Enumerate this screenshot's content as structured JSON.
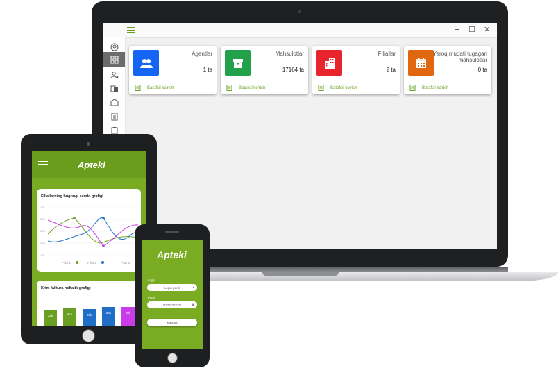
{
  "laptop": {
    "window_controls": {
      "minimize": "−",
      "maximize": "☐",
      "close": "✕"
    },
    "sidebar": {
      "items": [
        "user-circle-icon",
        "dashboard-icon",
        "user-settings-icon",
        "copy-icon",
        "box-icon",
        "document-icon",
        "clipboard-icon"
      ],
      "active_index": 1
    },
    "cards": [
      {
        "title": "Agentlar",
        "value": "1 ta",
        "link": "Batafsil ko'rish",
        "icon": "users-icon",
        "color": "#1565f5"
      },
      {
        "title": "Mahsulotlar",
        "value": "17164 ta",
        "link": "Batafsil ko'rish",
        "icon": "box-icon",
        "color": "#23a04a"
      },
      {
        "title": "Filiallar",
        "value": "2 ta",
        "link": "Batafsil ko'rish",
        "icon": "building-icon",
        "color": "#e8252d"
      },
      {
        "title": "Yaroq mudati tugagan mahsulotlar",
        "value": "0 ta",
        "link": "Batafsil ko'rish",
        "icon": "calendar-icon",
        "color": "#e0660f"
      }
    ]
  },
  "tablet": {
    "brand": "Apteki",
    "line_chart": {
      "title": "Filiallarning bugungi savdo grafigi",
      "y_ticks": [
        "20K",
        "20K",
        "20K",
        "20K",
        "20K"
      ],
      "legend": [
        "Filial 1",
        "Filial 2",
        "Filial 3"
      ],
      "colors": [
        "#6aa022",
        "#1f6fc9",
        "#c93ce8"
      ]
    },
    "bar_chart": {
      "title": "Krim faktura haftalik grafigi",
      "bars": [
        {
          "label": "25k",
          "value": 25,
          "color": "#6aa022"
        },
        {
          "label": "27k",
          "value": 27,
          "color": "#6aa022"
        },
        {
          "label": "26k",
          "value": 26,
          "color": "#1f6fc9"
        },
        {
          "label": "28k",
          "value": 28,
          "color": "#1f6fc9"
        },
        {
          "label": "28k",
          "value": 28,
          "color": "#c93ce8"
        }
      ]
    }
  },
  "phone": {
    "brand": "Apteki",
    "login_label": "Login",
    "login_value": "Login parol",
    "password_label": "Parol",
    "password_value": "***************",
    "submit_label": "KIRISH"
  }
}
